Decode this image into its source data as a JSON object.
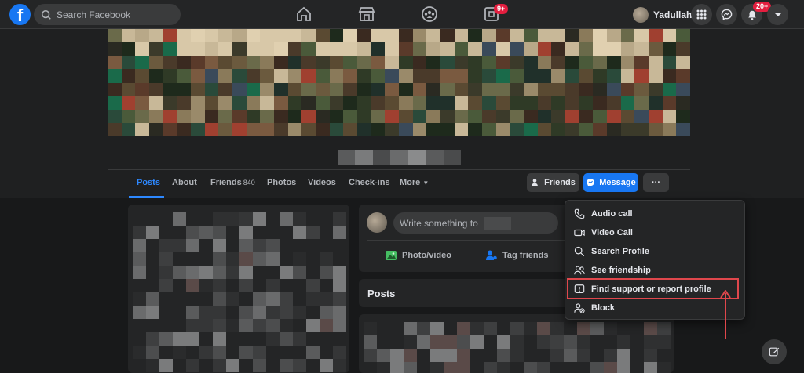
{
  "header": {
    "logo_letter": "f",
    "search_placeholder": "Search Facebook",
    "nav_icons": [
      "home-icon",
      "marketplace-icon",
      "groups-icon",
      "gaming-icon"
    ],
    "gaming_badge": "9+",
    "profile_name": "Yadullah",
    "notifications_badge": "20+"
  },
  "profile_tabs": {
    "items": [
      "Posts",
      "About",
      "Friends",
      "Photos",
      "Videos",
      "Check-ins",
      "More"
    ],
    "friends_count": "840",
    "active": "Posts"
  },
  "profile_actions": {
    "friends_label": "Friends",
    "message_label": "Message",
    "more_label": "···"
  },
  "composer": {
    "placeholder": "Write something to",
    "photo_video_label": "Photo/video",
    "tag_friends_label": "Tag friends"
  },
  "posts_header": "Posts",
  "dropdown_menu": {
    "items": [
      {
        "label": "Audio call",
        "icon": "phone-icon"
      },
      {
        "label": "Video Call",
        "icon": "video-camera-icon"
      },
      {
        "label": "Search Profile",
        "icon": "search-icon"
      },
      {
        "label": "See friendship",
        "icon": "friends-icon"
      },
      {
        "label": "Find support or report profile",
        "icon": "report-icon"
      },
      {
        "label": "Block",
        "icon": "block-user-icon"
      }
    ],
    "highlighted_item": "Find support or report profile"
  },
  "colors": {
    "accent": "#1877f2",
    "active_tab": "#2d88ff",
    "annotation": "#e0474c",
    "badge": "#e41e3f"
  }
}
